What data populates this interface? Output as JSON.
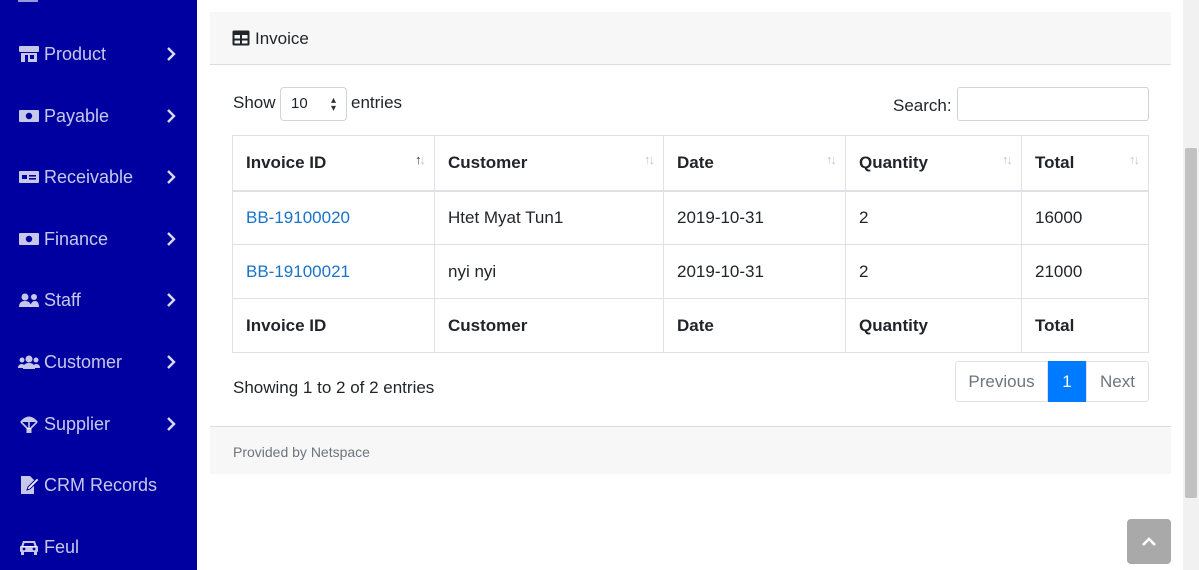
{
  "sidebar": {
    "items": [
      {
        "label": "Product",
        "icon": "store-icon",
        "chevron": true
      },
      {
        "label": "Payable",
        "icon": "money-bill-icon",
        "chevron": true
      },
      {
        "label": "Receivable",
        "icon": "money-check-icon",
        "chevron": true
      },
      {
        "label": "Finance",
        "icon": "money-bill-icon",
        "chevron": true
      },
      {
        "label": "Staff",
        "icon": "users-icon",
        "chevron": true
      },
      {
        "label": "Customer",
        "icon": "users-group-icon",
        "chevron": true
      },
      {
        "label": "Supplier",
        "icon": "parachute-icon",
        "chevron": true
      },
      {
        "label": "CRM Records",
        "icon": "edit-file-icon",
        "chevron": false
      },
      {
        "label": "Feul",
        "icon": "car-icon",
        "chevron": false
      }
    ],
    "color": "#0000a0"
  },
  "card": {
    "title": "Invoice",
    "show_label": "Show",
    "page_length": "10",
    "entries_label": "entries",
    "search_label": "Search:",
    "search_value": ""
  },
  "table": {
    "columns": [
      "Invoice ID",
      "Customer",
      "Date",
      "Quantity",
      "Total"
    ],
    "rows": [
      [
        "BB-19100020",
        "Htet Myat Tun1",
        "2019-10-31",
        "2",
        "16000"
      ],
      [
        "BB-19100021",
        "nyi nyi",
        "2019-10-31",
        "2",
        "21000"
      ]
    ],
    "footer": [
      "Invoice ID",
      "Customer",
      "Date",
      "Quantity",
      "Total"
    ],
    "link_color": "#1a73c9"
  },
  "info": "Showing 1 to 2 of 2 entries",
  "pagination": {
    "previous": "Previous",
    "current": "1",
    "next": "Next",
    "active_color": "#007bff"
  },
  "footer": {
    "text": "Provided by Netspace"
  }
}
